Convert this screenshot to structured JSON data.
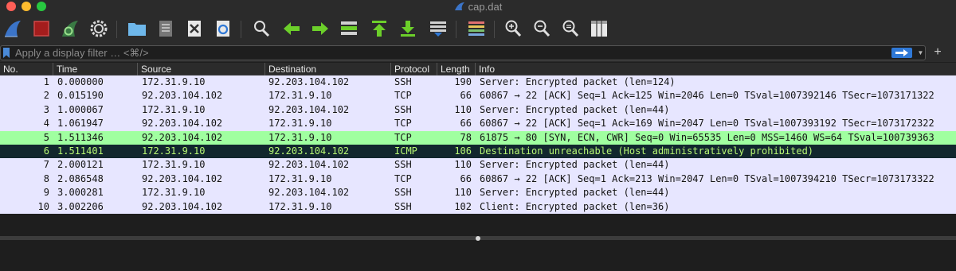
{
  "window": {
    "title": "cap.dat"
  },
  "toolbar": {
    "buttons": [
      {
        "name": "start-capture",
        "icon": "shark-fin-icon"
      },
      {
        "name": "stop-capture",
        "icon": "stop-square-icon"
      },
      {
        "name": "restart-capture",
        "icon": "restart-fin-icon"
      },
      {
        "name": "capture-options",
        "icon": "gear-icon"
      },
      {
        "name": "open-file",
        "icon": "folder-icon"
      },
      {
        "name": "save-file",
        "icon": "file-save-icon"
      },
      {
        "name": "close-file",
        "icon": "close-file-icon"
      },
      {
        "name": "reload-file",
        "icon": "reload-icon"
      },
      {
        "name": "find-packet",
        "icon": "magnifier-icon"
      },
      {
        "name": "go-back",
        "icon": "arrow-left-icon"
      },
      {
        "name": "go-forward",
        "icon": "arrow-right-icon"
      },
      {
        "name": "go-to-packet",
        "icon": "goto-packet-icon"
      },
      {
        "name": "go-first",
        "icon": "arrow-up-bar-icon"
      },
      {
        "name": "go-last",
        "icon": "arrow-down-bar-icon"
      },
      {
        "name": "autoscroll",
        "icon": "autoscroll-icon"
      },
      {
        "name": "colorize",
        "icon": "colorize-lines-icon"
      },
      {
        "name": "zoom-in",
        "icon": "zoom-in-icon"
      },
      {
        "name": "zoom-out",
        "icon": "zoom-out-icon"
      },
      {
        "name": "zoom-normal",
        "icon": "zoom-normal-icon"
      },
      {
        "name": "resize-columns",
        "icon": "resize-columns-icon"
      }
    ]
  },
  "filter": {
    "placeholder": "Apply a display filter … <⌘/>"
  },
  "columns": {
    "no": "No.",
    "time": "Time",
    "source": "Source",
    "destination": "Destination",
    "protocol": "Protocol",
    "length": "Length",
    "info": "Info"
  },
  "colors": {
    "ssh_row": "#e7e6ff",
    "tcp_row": "#e7e6ff",
    "syn_row": "#a0ffa0",
    "icmp_row": "#12272e",
    "icmp_text": "#b7f774"
  },
  "packets": [
    {
      "no": "1",
      "time": "0.000000",
      "source": "172.31.9.10",
      "destination": "92.203.104.102",
      "protocol": "SSH",
      "length": "190",
      "info": "Server: Encrypted packet (len=124)",
      "style": "ssh"
    },
    {
      "no": "2",
      "time": "0.015190",
      "source": "92.203.104.102",
      "destination": "172.31.9.10",
      "protocol": "TCP",
      "length": "66",
      "info": "60867 → 22 [ACK] Seq=1 Ack=125 Win=2046 Len=0 TSval=1007392146 TSecr=1073171322",
      "style": "tcp"
    },
    {
      "no": "3",
      "time": "1.000067",
      "source": "172.31.9.10",
      "destination": "92.203.104.102",
      "protocol": "SSH",
      "length": "110",
      "info": "Server: Encrypted packet (len=44)",
      "style": "ssh"
    },
    {
      "no": "4",
      "time": "1.061947",
      "source": "92.203.104.102",
      "destination": "172.31.9.10",
      "protocol": "TCP",
      "length": "66",
      "info": "60867 → 22 [ACK] Seq=1 Ack=169 Win=2047 Len=0 TSval=1007393192 TSecr=1073172322",
      "style": "tcp"
    },
    {
      "no": "5",
      "time": "1.511346",
      "source": "92.203.104.102",
      "destination": "172.31.9.10",
      "protocol": "TCP",
      "length": "78",
      "info": "61875 → 80 [SYN, ECN, CWR] Seq=0 Win=65535 Len=0 MSS=1460 WS=64 TSval=100739363",
      "style": "syn"
    },
    {
      "no": "6",
      "time": "1.511401",
      "source": "172.31.9.10",
      "destination": "92.203.104.102",
      "protocol": "ICMP",
      "length": "106",
      "info": "Destination unreachable (Host administratively prohibited)",
      "style": "icmp"
    },
    {
      "no": "7",
      "time": "2.000121",
      "source": "172.31.9.10",
      "destination": "92.203.104.102",
      "protocol": "SSH",
      "length": "110",
      "info": "Server: Encrypted packet (len=44)",
      "style": "ssh"
    },
    {
      "no": "8",
      "time": "2.086548",
      "source": "92.203.104.102",
      "destination": "172.31.9.10",
      "protocol": "TCP",
      "length": "66",
      "info": "60867 → 22 [ACK] Seq=1 Ack=213 Win=2047 Len=0 TSval=1007394210 TSecr=1073173322",
      "style": "tcp"
    },
    {
      "no": "9",
      "time": "3.000281",
      "source": "172.31.9.10",
      "destination": "92.203.104.102",
      "protocol": "SSH",
      "length": "110",
      "info": "Server: Encrypted packet (len=44)",
      "style": "ssh"
    },
    {
      "no": "10",
      "time": "3.002206",
      "source": "92.203.104.102",
      "destination": "172.31.9.10",
      "protocol": "SSH",
      "length": "102",
      "info": "Client: Encrypted packet (len=36)",
      "style": "ssh"
    }
  ]
}
